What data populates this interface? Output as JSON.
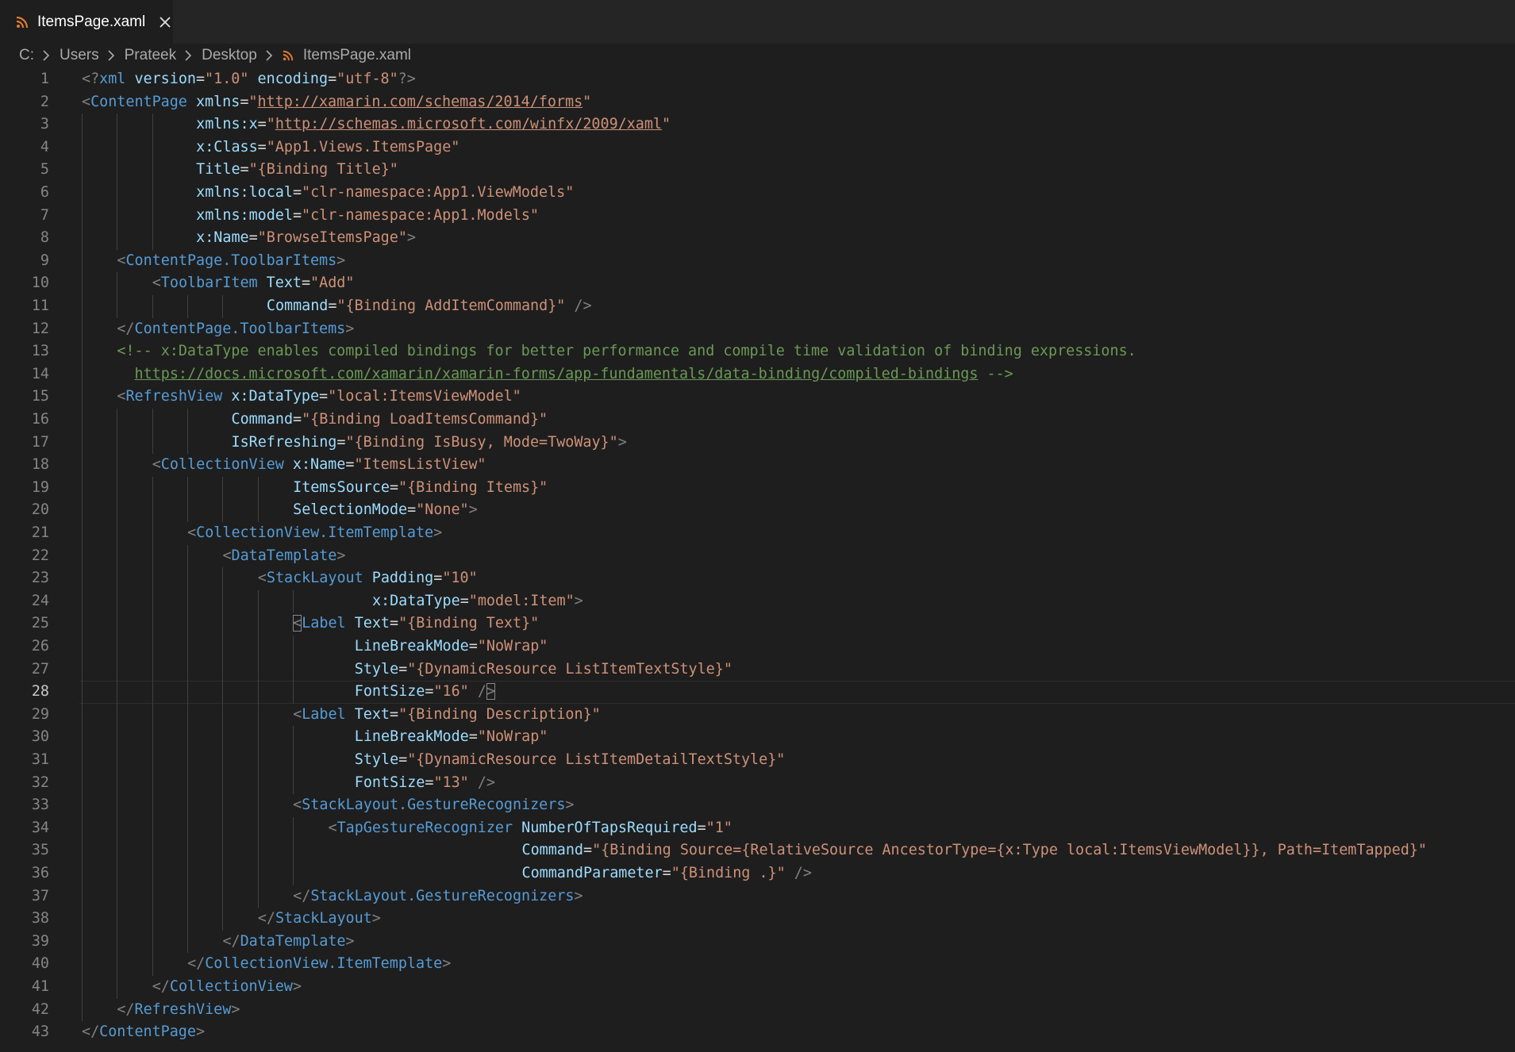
{
  "tab": {
    "title": "ItemsPage.xaml",
    "icon": "rss-icon",
    "accent": "#e37933"
  },
  "breadcrumb": [
    "C:",
    "Users",
    "Prateek",
    "Desktop",
    "ItemsPage.xaml"
  ],
  "editor": {
    "current_line": 28,
    "lines": [
      {
        "n": "1",
        "indent": 0,
        "tokens": [
          [
            "p",
            "<?"
          ],
          [
            "t",
            "xml"
          ],
          [
            "e",
            " "
          ],
          [
            "a",
            "version"
          ],
          [
            "e",
            "="
          ],
          [
            "s",
            "\"1.0\""
          ],
          [
            "e",
            " "
          ],
          [
            "a",
            "encoding"
          ],
          [
            "e",
            "="
          ],
          [
            "s",
            "\"utf-8\""
          ],
          [
            "p",
            "?>"
          ]
        ]
      },
      {
        "n": "2",
        "indent": 0,
        "tokens": [
          [
            "p",
            "<"
          ],
          [
            "t",
            "ContentPage"
          ],
          [
            "e",
            " "
          ],
          [
            "a",
            "xmlns"
          ],
          [
            "e",
            "="
          ],
          [
            "s",
            "\""
          ],
          [
            "su",
            "http://xamarin.com/schemas/2014/forms"
          ],
          [
            "s",
            "\""
          ]
        ]
      },
      {
        "n": "3",
        "indent": 13,
        "tokens": [
          [
            "a",
            "xmlns:x"
          ],
          [
            "e",
            "="
          ],
          [
            "s",
            "\""
          ],
          [
            "su",
            "http://schemas.microsoft.com/winfx/2009/xaml"
          ],
          [
            "s",
            "\""
          ]
        ]
      },
      {
        "n": "4",
        "indent": 13,
        "tokens": [
          [
            "a",
            "x:Class"
          ],
          [
            "e",
            "="
          ],
          [
            "s",
            "\"App1.Views.ItemsPage\""
          ]
        ]
      },
      {
        "n": "5",
        "indent": 13,
        "tokens": [
          [
            "a",
            "Title"
          ],
          [
            "e",
            "="
          ],
          [
            "s",
            "\"{Binding Title}\""
          ]
        ]
      },
      {
        "n": "6",
        "indent": 13,
        "tokens": [
          [
            "a",
            "xmlns:local"
          ],
          [
            "e",
            "="
          ],
          [
            "s",
            "\"clr-namespace:App1.ViewModels\""
          ]
        ]
      },
      {
        "n": "7",
        "indent": 13,
        "tokens": [
          [
            "a",
            "xmlns:model"
          ],
          [
            "e",
            "="
          ],
          [
            "s",
            "\"clr-namespace:App1.Models\""
          ]
        ]
      },
      {
        "n": "8",
        "indent": 13,
        "tokens": [
          [
            "a",
            "x:Name"
          ],
          [
            "e",
            "="
          ],
          [
            "s",
            "\"BrowseItemsPage\""
          ],
          [
            "p",
            ">"
          ]
        ]
      },
      {
        "n": "9",
        "indent": 4,
        "tokens": [
          [
            "p",
            "<"
          ],
          [
            "t",
            "ContentPage.ToolbarItems"
          ],
          [
            "p",
            ">"
          ]
        ]
      },
      {
        "n": "10",
        "indent": 8,
        "tokens": [
          [
            "p",
            "<"
          ],
          [
            "t",
            "ToolbarItem"
          ],
          [
            "e",
            " "
          ],
          [
            "a",
            "Text"
          ],
          [
            "e",
            "="
          ],
          [
            "s",
            "\"Add\""
          ]
        ]
      },
      {
        "n": "11",
        "indent": 21,
        "tokens": [
          [
            "a",
            "Command"
          ],
          [
            "e",
            "="
          ],
          [
            "s",
            "\"{Binding AddItemCommand}\""
          ],
          [
            "e",
            " "
          ],
          [
            "p",
            "/>"
          ]
        ]
      },
      {
        "n": "12",
        "indent": 4,
        "tokens": [
          [
            "p",
            "</"
          ],
          [
            "t",
            "ContentPage.ToolbarItems"
          ],
          [
            "p",
            ">"
          ]
        ]
      },
      {
        "n": "13",
        "indent": 4,
        "tokens": [
          [
            "c",
            "<!-- x:DataType enables compiled bindings for better performance and compile time validation of binding expressions."
          ]
        ]
      },
      {
        "n": "14",
        "indent": 6,
        "tokens": [
          [
            "cu",
            "https://docs.microsoft.com/xamarin/xamarin-forms/app-fundamentals/data-binding/compiled-bindings"
          ],
          [
            "c",
            " -->"
          ]
        ]
      },
      {
        "n": "15",
        "indent": 4,
        "tokens": [
          [
            "p",
            "<"
          ],
          [
            "t",
            "RefreshView"
          ],
          [
            "e",
            " "
          ],
          [
            "a",
            "x:DataType"
          ],
          [
            "e",
            "="
          ],
          [
            "s",
            "\"local:ItemsViewModel\""
          ]
        ]
      },
      {
        "n": "16",
        "indent": 17,
        "tokens": [
          [
            "a",
            "Command"
          ],
          [
            "e",
            "="
          ],
          [
            "s",
            "\"{Binding LoadItemsCommand}\""
          ]
        ]
      },
      {
        "n": "17",
        "indent": 17,
        "tokens": [
          [
            "a",
            "IsRefreshing"
          ],
          [
            "e",
            "="
          ],
          [
            "s",
            "\"{Binding IsBusy, Mode=TwoWay}\""
          ],
          [
            "p",
            ">"
          ]
        ]
      },
      {
        "n": "18",
        "indent": 8,
        "tokens": [
          [
            "p",
            "<"
          ],
          [
            "t",
            "CollectionView"
          ],
          [
            "e",
            " "
          ],
          [
            "a",
            "x:Name"
          ],
          [
            "e",
            "="
          ],
          [
            "s",
            "\"ItemsListView\""
          ]
        ]
      },
      {
        "n": "19",
        "indent": 24,
        "tokens": [
          [
            "a",
            "ItemsSource"
          ],
          [
            "e",
            "="
          ],
          [
            "s",
            "\"{Binding Items}\""
          ]
        ]
      },
      {
        "n": "20",
        "indent": 24,
        "tokens": [
          [
            "a",
            "SelectionMode"
          ],
          [
            "e",
            "="
          ],
          [
            "s",
            "\"None\""
          ],
          [
            "p",
            ">"
          ]
        ]
      },
      {
        "n": "21",
        "indent": 12,
        "tokens": [
          [
            "p",
            "<"
          ],
          [
            "t",
            "CollectionView.ItemTemplate"
          ],
          [
            "p",
            ">"
          ]
        ]
      },
      {
        "n": "22",
        "indent": 16,
        "tokens": [
          [
            "p",
            "<"
          ],
          [
            "t",
            "DataTemplate"
          ],
          [
            "p",
            ">"
          ]
        ]
      },
      {
        "n": "23",
        "indent": 20,
        "tokens": [
          [
            "p",
            "<"
          ],
          [
            "t",
            "StackLayout"
          ],
          [
            "e",
            " "
          ],
          [
            "a",
            "Padding"
          ],
          [
            "e",
            "="
          ],
          [
            "s",
            "\"10\""
          ]
        ]
      },
      {
        "n": "24",
        "indent": 33,
        "tokens": [
          [
            "a",
            "x:DataType"
          ],
          [
            "e",
            "="
          ],
          [
            "s",
            "\"model:Item\""
          ],
          [
            "p",
            ">"
          ]
        ]
      },
      {
        "n": "25",
        "indent": 24,
        "tokens": [
          [
            "pb",
            "<"
          ],
          [
            "t",
            "Label"
          ],
          [
            "e",
            " "
          ],
          [
            "a",
            "Text"
          ],
          [
            "e",
            "="
          ],
          [
            "s",
            "\"{Binding Text}\""
          ]
        ]
      },
      {
        "n": "26",
        "indent": 31,
        "tokens": [
          [
            "a",
            "LineBreakMode"
          ],
          [
            "e",
            "="
          ],
          [
            "s",
            "\"NoWrap\""
          ]
        ]
      },
      {
        "n": "27",
        "indent": 31,
        "tokens": [
          [
            "a",
            "Style"
          ],
          [
            "e",
            "="
          ],
          [
            "s",
            "\"{DynamicResource ListItemTextStyle}\""
          ]
        ]
      },
      {
        "n": "28",
        "indent": 31,
        "tokens": [
          [
            "a",
            "FontSize"
          ],
          [
            "e",
            "="
          ],
          [
            "s",
            "\"16\""
          ],
          [
            "e",
            " "
          ],
          [
            "p",
            "/"
          ],
          [
            "pb",
            ">"
          ]
        ]
      },
      {
        "n": "29",
        "indent": 24,
        "tokens": [
          [
            "p",
            "<"
          ],
          [
            "t",
            "Label"
          ],
          [
            "e",
            " "
          ],
          [
            "a",
            "Text"
          ],
          [
            "e",
            "="
          ],
          [
            "s",
            "\"{Binding Description}\""
          ]
        ]
      },
      {
        "n": "30",
        "indent": 31,
        "tokens": [
          [
            "a",
            "LineBreakMode"
          ],
          [
            "e",
            "="
          ],
          [
            "s",
            "\"NoWrap\""
          ]
        ]
      },
      {
        "n": "31",
        "indent": 31,
        "tokens": [
          [
            "a",
            "Style"
          ],
          [
            "e",
            "="
          ],
          [
            "s",
            "\"{DynamicResource ListItemDetailTextStyle}\""
          ]
        ]
      },
      {
        "n": "32",
        "indent": 31,
        "tokens": [
          [
            "a",
            "FontSize"
          ],
          [
            "e",
            "="
          ],
          [
            "s",
            "\"13\""
          ],
          [
            "e",
            " "
          ],
          [
            "p",
            "/>"
          ]
        ]
      },
      {
        "n": "33",
        "indent": 24,
        "tokens": [
          [
            "p",
            "<"
          ],
          [
            "t",
            "StackLayout.GestureRecognizers"
          ],
          [
            "p",
            ">"
          ]
        ]
      },
      {
        "n": "34",
        "indent": 28,
        "tokens": [
          [
            "p",
            "<"
          ],
          [
            "t",
            "TapGestureRecognizer"
          ],
          [
            "e",
            " "
          ],
          [
            "a",
            "NumberOfTapsRequired"
          ],
          [
            "e",
            "="
          ],
          [
            "s",
            "\"1\""
          ]
        ]
      },
      {
        "n": "35",
        "indent": 50,
        "tokens": [
          [
            "a",
            "Command"
          ],
          [
            "e",
            "="
          ],
          [
            "s",
            "\"{Binding Source={RelativeSource AncestorType={x:Type local:ItemsViewModel}}, Path=ItemTapped}\""
          ]
        ]
      },
      {
        "n": "36",
        "indent": 50,
        "tokens": [
          [
            "a",
            "CommandParameter"
          ],
          [
            "e",
            "="
          ],
          [
            "s",
            "\"{Binding .}\""
          ],
          [
            "e",
            " "
          ],
          [
            "p",
            "/>"
          ]
        ]
      },
      {
        "n": "37",
        "indent": 24,
        "tokens": [
          [
            "p",
            "</"
          ],
          [
            "t",
            "StackLayout.GestureRecognizers"
          ],
          [
            "p",
            ">"
          ]
        ]
      },
      {
        "n": "38",
        "indent": 20,
        "tokens": [
          [
            "p",
            "</"
          ],
          [
            "t",
            "StackLayout"
          ],
          [
            "p",
            ">"
          ]
        ]
      },
      {
        "n": "39",
        "indent": 16,
        "tokens": [
          [
            "p",
            "</"
          ],
          [
            "t",
            "DataTemplate"
          ],
          [
            "p",
            ">"
          ]
        ]
      },
      {
        "n": "40",
        "indent": 12,
        "tokens": [
          [
            "p",
            "</"
          ],
          [
            "t",
            "CollectionView.ItemTemplate"
          ],
          [
            "p",
            ">"
          ]
        ]
      },
      {
        "n": "41",
        "indent": 8,
        "tokens": [
          [
            "p",
            "</"
          ],
          [
            "t",
            "CollectionView"
          ],
          [
            "p",
            ">"
          ]
        ]
      },
      {
        "n": "42",
        "indent": 4,
        "tokens": [
          [
            "p",
            "</"
          ],
          [
            "t",
            "RefreshView"
          ],
          [
            "p",
            ">"
          ]
        ]
      },
      {
        "n": "43",
        "indent": 0,
        "tokens": [
          [
            "p",
            "</"
          ],
          [
            "t",
            "ContentPage"
          ],
          [
            "p",
            ">"
          ]
        ]
      }
    ]
  }
}
